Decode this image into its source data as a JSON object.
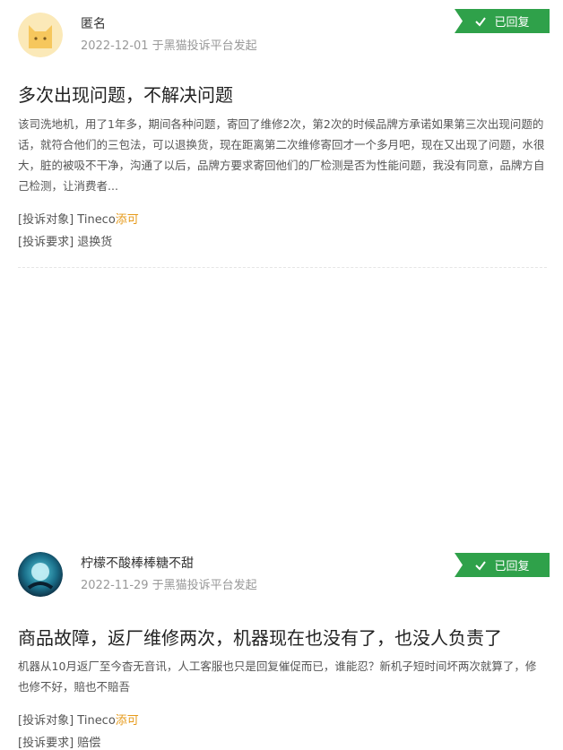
{
  "badge_color": "#2fa14a",
  "brand_color": "#e69a1a",
  "posts": [
    {
      "user_name": "匿名",
      "meta": "2022-12-01 于黑猫投诉平台发起",
      "status": "已回复",
      "title": "多次出现问题，不解决问题",
      "body": "该司洗地机，用了1年多，期间各种问题，寄回了维修2次，第2次的时候品牌方承诺如果第三次出现问题的话，就符合他们的三包法，可以退换货，现在距离第二次维修寄回才一个多月吧，现在又出现了问题，水很大，脏的被吸不干净，沟通了以后，品牌方要求寄回他们的厂检测是否为性能问题，我没有同意，品牌方自己检测，让消费者...",
      "target_label": "[投诉对象]",
      "target_value": "Tineco添可",
      "target_brand_prefix": "Tineco",
      "target_brand_suffix": "添可",
      "request_label": "[投诉要求]",
      "request_value": "退换货"
    },
    {
      "user_name": "柠檬不酸棒棒糖不甜",
      "meta": "2022-11-29 于黑猫投诉平台发起",
      "status": "已回复",
      "title": "商品故障，返厂维修两次，机器现在也没有了，也没人负责了",
      "body": "机器从10月返厂至今杳无音讯，人工客服也只是回复催促而已，谁能忍？新机子短时间坏两次就算了，修也修不好，賠也不賠吾",
      "target_label": "[投诉对象]",
      "target_value": "Tineco添可",
      "target_brand_prefix": "Tineco",
      "target_brand_suffix": "添可",
      "request_label": "[投诉要求]",
      "request_value": "赔偿"
    }
  ]
}
